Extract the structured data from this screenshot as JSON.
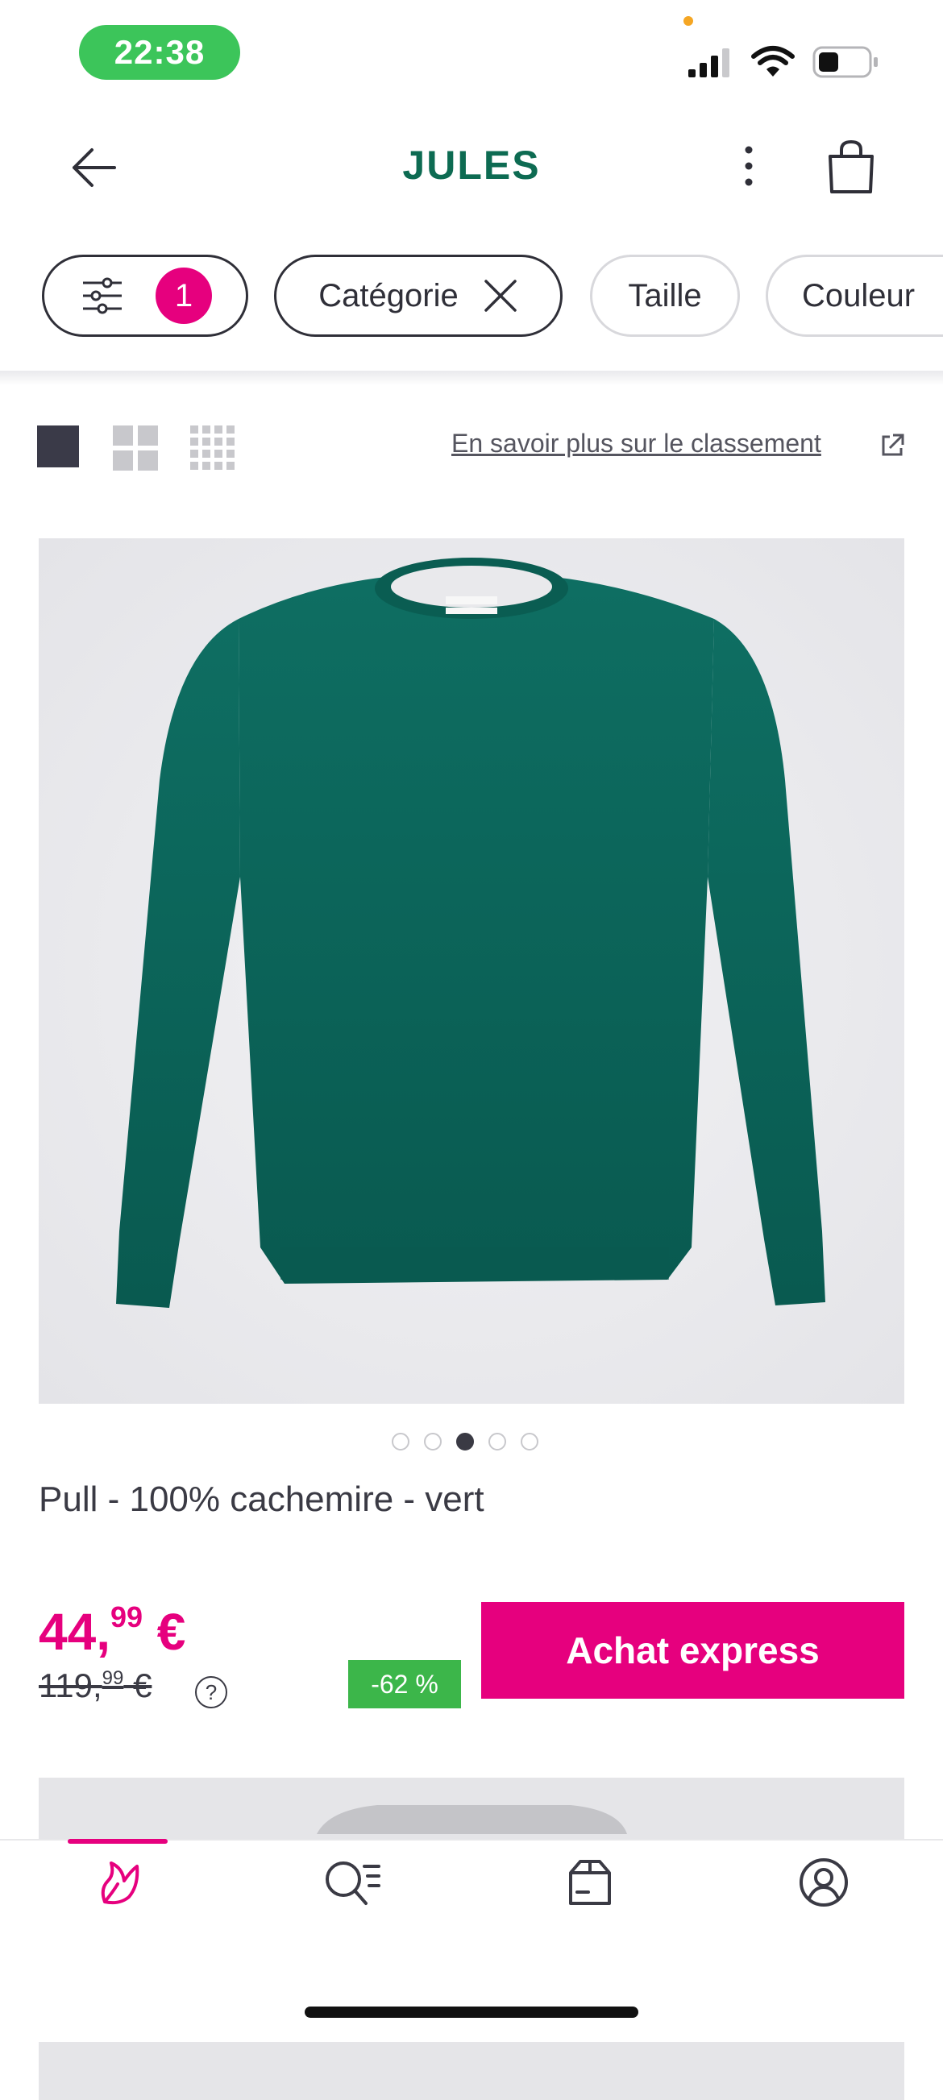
{
  "status_bar": {
    "time": "22:38"
  },
  "header": {
    "logo_text": "JULES"
  },
  "filters": {
    "filter_count": "1",
    "chips": [
      "Catégorie",
      "Taille",
      "Couleur"
    ]
  },
  "view_options": {
    "learn_more_link": "En savoir plus sur le classement"
  },
  "product": {
    "title": "Pull - 100% cachemire - vert",
    "image_dots_total": 5,
    "image_dots_active_index": 2,
    "price_main": "44,",
    "price_cents": "99",
    "price_currency": " €",
    "old_price_main": "119,",
    "old_price_cents": "99",
    "old_price_currency": " €",
    "help_symbol": "?",
    "discount": "-62 %",
    "express_button": "Achat express"
  },
  "colors": {
    "accent": "#e6007e",
    "brand": "#0d6b52",
    "discount": "#3cb64a",
    "product_green": "#0b6b5e"
  },
  "bottom_nav": {
    "items": [
      "home-icon",
      "search-list-icon",
      "order-box-icon",
      "account-icon"
    ],
    "active_index": 0
  }
}
